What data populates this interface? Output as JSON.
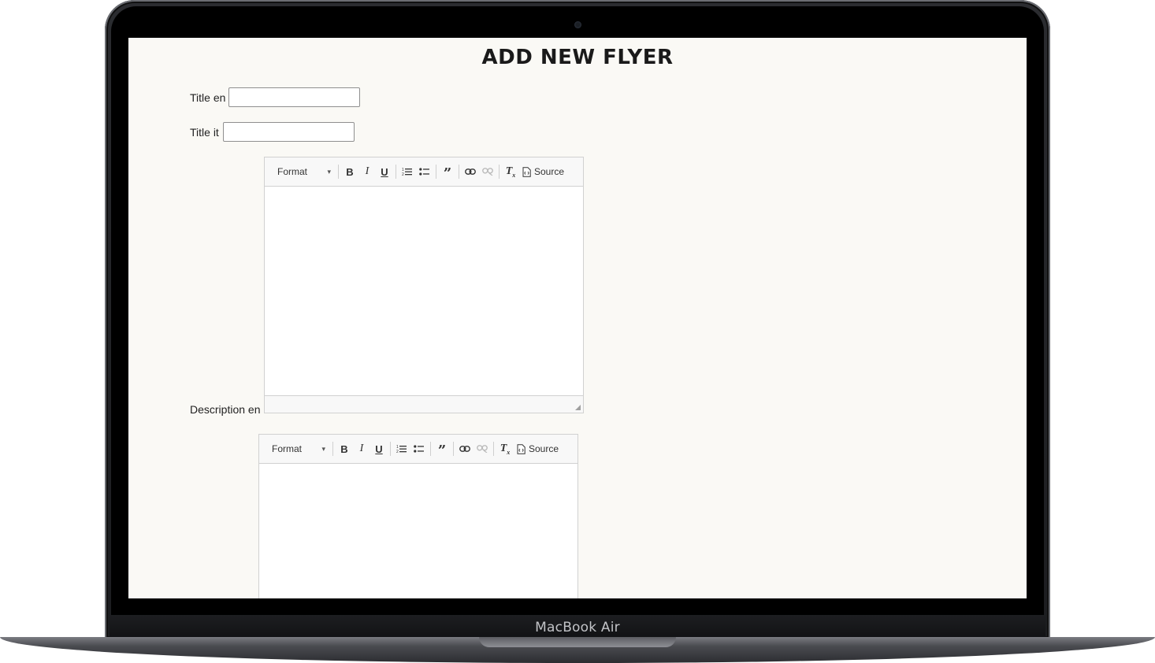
{
  "device": {
    "brand_label": "MacBook Air"
  },
  "page": {
    "title": "ADD NEW FLYER",
    "background_color": "#faf9f5"
  },
  "form": {
    "title_en": {
      "label": "Title en",
      "value": ""
    },
    "title_it": {
      "label": "Title it",
      "value": ""
    },
    "description_en": {
      "label": "Description en"
    }
  },
  "editor_toolbar": {
    "format_label": "Format",
    "source_label": "Source",
    "buttons": [
      {
        "name": "bold",
        "icon": "bold-icon",
        "glyph": "B"
      },
      {
        "name": "italic",
        "icon": "italic-icon",
        "glyph": "I"
      },
      {
        "name": "underline",
        "icon": "underline-icon",
        "glyph": "U"
      },
      {
        "name": "numbered-list",
        "icon": "numbered-list-icon"
      },
      {
        "name": "bulleted-list",
        "icon": "bulleted-list-icon"
      },
      {
        "name": "blockquote",
        "icon": "blockquote-icon"
      },
      {
        "name": "link",
        "icon": "link-icon"
      },
      {
        "name": "unlink",
        "icon": "unlink-icon",
        "disabled": true
      },
      {
        "name": "remove-format",
        "icon": "remove-format-icon"
      },
      {
        "name": "source",
        "icon": "source-icon"
      }
    ]
  }
}
